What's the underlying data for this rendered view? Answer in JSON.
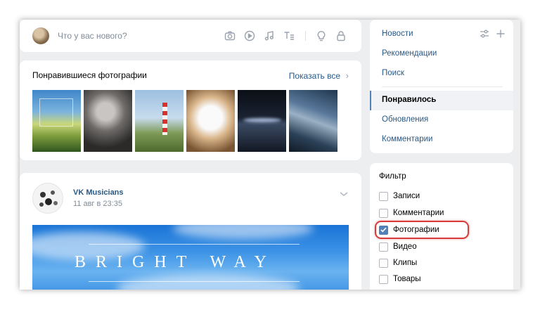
{
  "composer": {
    "placeholder": "Что у вас нового?",
    "tools": [
      "camera-icon",
      "play-icon",
      "music-icon",
      "text-format-icon",
      "lightbulb-icon",
      "lock-icon"
    ]
  },
  "liked_photos": {
    "title": "Понравившиеся фотографии",
    "show_all": "Показать все",
    "chevron": "›"
  },
  "post": {
    "author": "VK Musicians",
    "date": "11 авг в 23:35",
    "banner_text": "BRIGHT WAY"
  },
  "nav": {
    "items": [
      {
        "label": "Новости"
      },
      {
        "label": "Рекомендации"
      },
      {
        "label": "Поиск"
      }
    ],
    "active": "Понравилось",
    "after": [
      {
        "label": "Обновления"
      },
      {
        "label": "Комментарии"
      }
    ]
  },
  "filter": {
    "title": "Фильтр",
    "options": [
      {
        "label": "Записи",
        "checked": false
      },
      {
        "label": "Комментарии",
        "checked": false
      },
      {
        "label": "Фотографии",
        "checked": true
      },
      {
        "label": "Видео",
        "checked": false
      },
      {
        "label": "Клипы",
        "checked": false
      },
      {
        "label": "Товары",
        "checked": false
      }
    ]
  },
  "colors": {
    "accent": "#5181b8",
    "link": "#2a5885",
    "highlight": "#d93a3a",
    "background": "#edeef0"
  }
}
